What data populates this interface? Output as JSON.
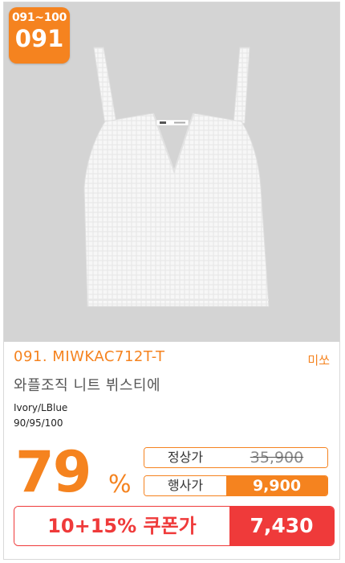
{
  "badge": {
    "range": "091~100",
    "number": "091"
  },
  "product": {
    "code": "091. MIWKAC712T-T",
    "brand": "미쏘",
    "name": "와플조직 니트 뷔스티에",
    "color": "Ivory/LBlue",
    "sizes": "90/95/100",
    "image_icon": "knit-top-image"
  },
  "price": {
    "discount": "79",
    "discount_unit": "%",
    "regular_label": "정상가",
    "regular_value": "35,900",
    "event_label": "행사가",
    "event_value": "9,900",
    "coupon_label": "10+15% 쿠폰가",
    "coupon_value": "7,430"
  },
  "colors": {
    "accent": "#f5831f",
    "coupon": "#ef3a3a",
    "photo_bg": "#d4d4d4"
  }
}
